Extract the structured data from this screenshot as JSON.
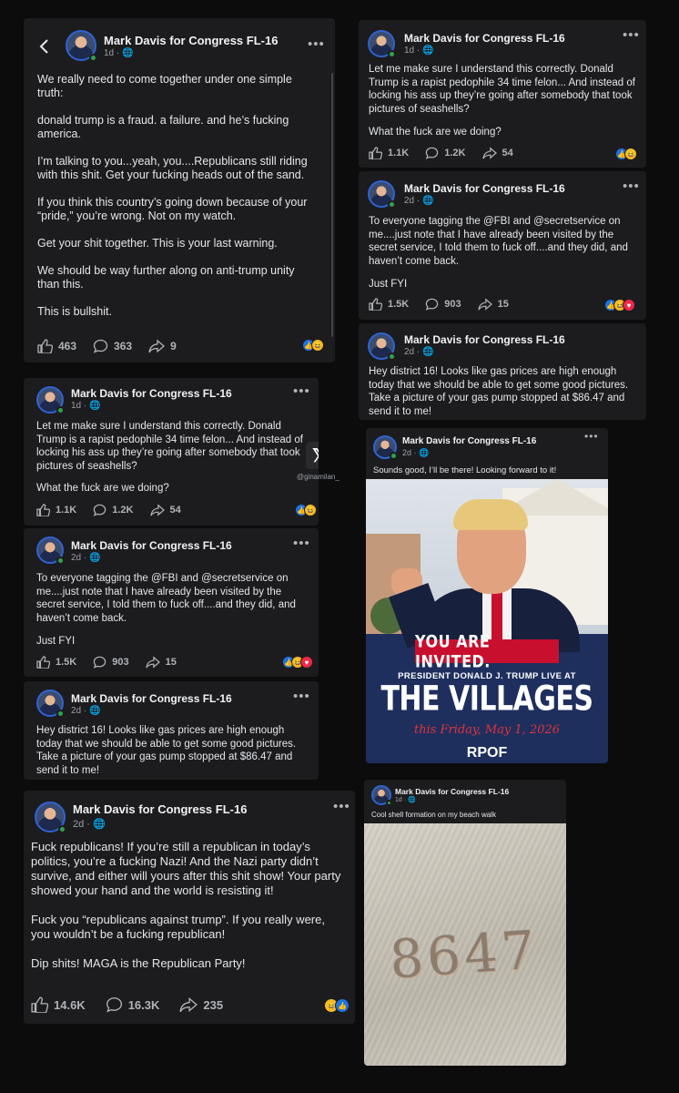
{
  "page_name": "Mark Davis for Congress FL-16",
  "main_post": {
    "time": "1d",
    "lines": [
      "We really need to come together under one simple truth:",
      "donald trump is a fraud. a failure. and he’s fucking america.",
      "I’m talking to you...yeah, you....Republicans still riding with this shit. Get your fucking heads out of the sand.",
      "If you think this country’s going down because of your “pride,” you’re wrong. Not on my watch.",
      "Get your shit together. This is your last warning.",
      "We should be way further along on anti-trump unity than this.",
      "This is bullshit."
    ],
    "likes": "463",
    "comments": "363",
    "shares": "9"
  },
  "post_seashells": {
    "time": "1d",
    "text": "Let me make sure I understand this correctly. Donald Trump is a rapist pedophile 34 time felon... And instead of locking his ass up they’re going after somebody that took pictures of seashells?",
    "text2": "What the fuck are we doing?",
    "likes": "1.1K",
    "comments": "1.2K",
    "shares": "54"
  },
  "post_fbi": {
    "time": "2d",
    "text": "To everyone tagging the @FBI and @secretservice on me....just note that I have already been visited by the secret service, I told them to fuck off....and they did, and haven’t come back.",
    "text2": "Just FYI",
    "likes": "1.5K",
    "comments": "903",
    "shares": "15"
  },
  "post_gas": {
    "time": "2d",
    "text": "Hey district 16! Looks like gas prices are high enough today that we should be able to get some good pictures. Take a picture of your gas pump stopped at $86.47 and send it to me!"
  },
  "post_republicans": {
    "time": "2d",
    "lines": [
      "Fuck republicans! If you’re still a republican in today’s politics, you’re a fucking Nazi! And the Nazi party didn’t survive, and either will yours after this shit show! Your party showed your hand and the world is resisting it!",
      "Fuck you “republicans against trump”. If you really were, you wouldn’t be a fucking republican!",
      "Dip shits! MAGA is the Republican Party!"
    ],
    "likes": "14.6K",
    "comments": "16.3K",
    "shares": "235"
  },
  "post_villages": {
    "time": "2d",
    "text": "Sounds good, I’ll be there! Looking forward to it!",
    "banner": "YOU ARE INVITED.",
    "subtitle": "PRESIDENT DONALD J. TRUMP LIVE AT",
    "headline": "THE VILLAGES",
    "date": "this Friday, May 1, 2026",
    "logo": "RPOF"
  },
  "post_shells": {
    "time": "1d",
    "text": "Cool shell formation on my beach walk",
    "shell_digits": "8647"
  },
  "watermark": "@ginamilan_",
  "colors": {
    "card": "#1c1c1e",
    "background": "#0c0c0d",
    "accent": "#1b74e4",
    "banner_red": "#c8102e",
    "navy": "#1e2f5e"
  }
}
